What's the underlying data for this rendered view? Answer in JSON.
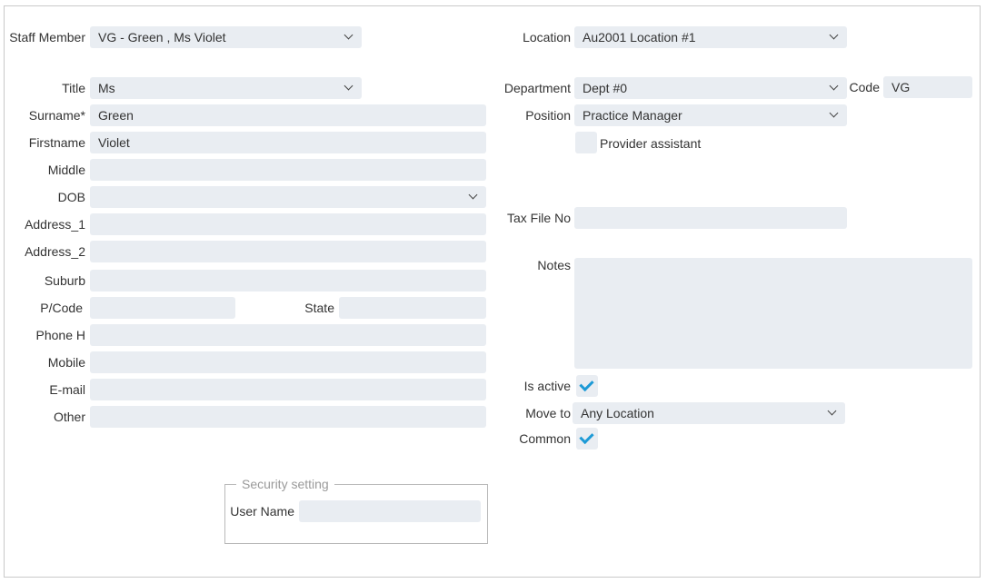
{
  "left": {
    "staff_member": {
      "label": "Staff Member",
      "value": "VG -  Green , Ms Violet"
    },
    "title": {
      "label": "Title",
      "value": "Ms"
    },
    "surname": {
      "label": "Surname*",
      "value": "Green"
    },
    "firstname": {
      "label": "Firstname",
      "value": "Violet"
    },
    "middle": {
      "label": "Middle",
      "value": ""
    },
    "dob": {
      "label": "DOB",
      "value": ""
    },
    "address_1": {
      "label": "Address_1",
      "value": ""
    },
    "address_2": {
      "label": "Address_2",
      "value": ""
    },
    "suburb": {
      "label": "Suburb",
      "value": ""
    },
    "pcode": {
      "label": "P/Code",
      "value": ""
    },
    "state": {
      "label": "State",
      "value": ""
    },
    "phone_h": {
      "label": "Phone H",
      "value": ""
    },
    "mobile": {
      "label": "Mobile",
      "value": ""
    },
    "email": {
      "label": "E-mail",
      "value": ""
    },
    "other": {
      "label": "Other",
      "value": ""
    }
  },
  "right": {
    "location": {
      "label": "Location",
      "value": "Au2001 Location #1"
    },
    "department": {
      "label": "Department",
      "value": "Dept #0"
    },
    "code": {
      "label": "Code",
      "value": "VG"
    },
    "position": {
      "label": "Position",
      "value": "Practice Manager"
    },
    "provider_assistant": {
      "label": "Provider assistant",
      "checked": false
    },
    "tax_file_no": {
      "label": "Tax File No",
      "value": ""
    },
    "notes": {
      "label": "Notes",
      "value": ""
    },
    "is_active": {
      "label": "Is active",
      "checked": true
    },
    "move_to": {
      "label": "Move to",
      "value": "Any Location"
    },
    "common": {
      "label": "Common",
      "checked": true
    }
  },
  "security": {
    "legend": "Security setting",
    "user_name": {
      "label": "User Name",
      "value": ""
    }
  }
}
